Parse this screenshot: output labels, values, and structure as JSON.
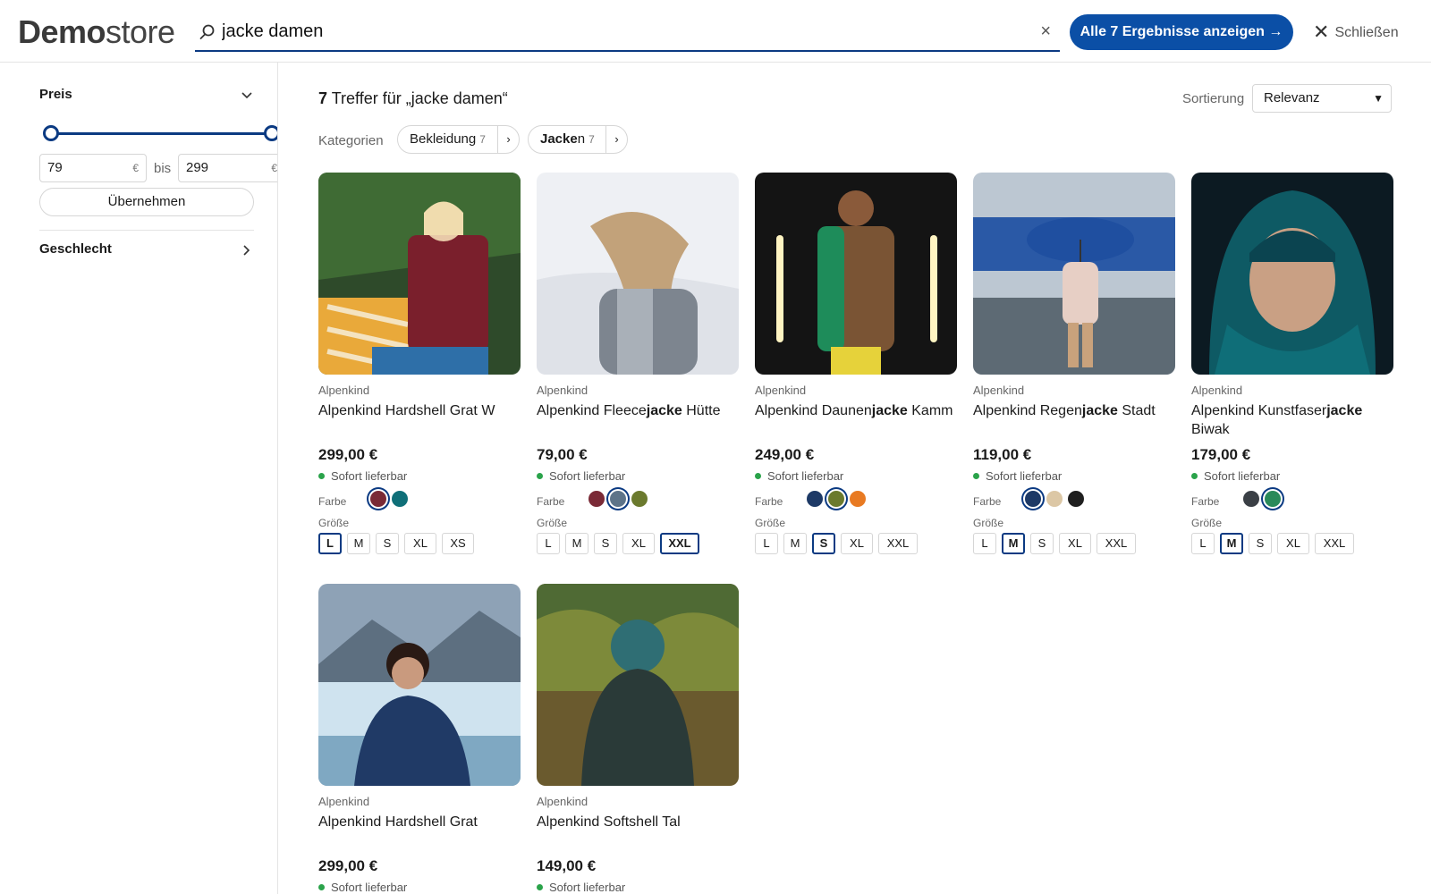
{
  "header": {
    "logo_bold": "Demo",
    "logo_light": "store",
    "search_value": "jacke damen",
    "clear_symbol": "×",
    "cta_label": "Alle 7 Ergebnisse anzeigen →",
    "close_label": "Schließen",
    "close_symbol": "✕"
  },
  "sidebar": {
    "price_title": "Preis",
    "price_min": "79",
    "price_max": "299",
    "currency": "€",
    "bis": "bis",
    "apply_label": "Übernehmen",
    "gender_title": "Geschlecht"
  },
  "main": {
    "results_count": "7",
    "results_text": " Treffer für „jacke damen“",
    "sort_label": "Sortierung",
    "sort_value": "Relevanz",
    "categories_label": "Kategorien",
    "categories": [
      {
        "label": "Bekleidung",
        "count": "7"
      },
      {
        "label_match": "Jacke",
        "label_rest": "n",
        "count": "7"
      }
    ]
  },
  "colors": {
    "accent": "#0b4fa6",
    "accent_dark": "#0b3a82",
    "available": "#2aa34a"
  },
  "products": [
    {
      "brand": "Alpenkind",
      "name_pre": "Alpenkind Hardshell Grat W",
      "name_match": "",
      "name_post": "",
      "price": "299,00 €",
      "availability": "Sofort lieferbar",
      "farbe_label": "Farbe",
      "groesse_label": "Größe",
      "swatches": [
        {
          "color": "#7a2a36",
          "selected": true
        },
        {
          "color": "#0f6f78",
          "selected": false
        }
      ],
      "sizes": [
        "L",
        "M",
        "S",
        "XL",
        "XS"
      ],
      "selected_size": "L"
    },
    {
      "brand": "Alpenkind",
      "name_pre": "Alpenkind Fleece",
      "name_match": "jacke",
      "name_post": " Hütte",
      "price": "79,00 €",
      "availability": "Sofort lieferbar",
      "farbe_label": "Farbe",
      "groesse_label": "Größe",
      "swatches": [
        {
          "color": "#7a2a36",
          "selected": false
        },
        {
          "color": "#5e7489",
          "selected": true
        },
        {
          "color": "#6b7a2e",
          "selected": false
        }
      ],
      "sizes": [
        "L",
        "M",
        "S",
        "XL",
        "XXL"
      ],
      "selected_size": "XXL"
    },
    {
      "brand": "Alpenkind",
      "name_pre": "Alpenkind Daunen",
      "name_match": "jacke",
      "name_post": " Kamm",
      "price": "249,00 €",
      "availability": "Sofort lieferbar",
      "farbe_label": "Farbe",
      "groesse_label": "Größe",
      "swatches": [
        {
          "color": "#1d3966",
          "selected": false
        },
        {
          "color": "#6b7a2e",
          "selected": true
        },
        {
          "color": "#e87a22",
          "selected": false
        }
      ],
      "sizes": [
        "L",
        "M",
        "S",
        "XL",
        "XXL"
      ],
      "selected_size": "S"
    },
    {
      "brand": "Alpenkind",
      "name_pre": "Alpenkind Regen",
      "name_match": "jacke",
      "name_post": " Stadt",
      "price": "119,00 €",
      "availability": "Sofort lieferbar",
      "farbe_label": "Farbe",
      "groesse_label": "Größe",
      "swatches": [
        {
          "color": "#1d3966",
          "selected": true
        },
        {
          "color": "#dcc7a5",
          "selected": false
        },
        {
          "color": "#1f1f1f",
          "selected": false
        }
      ],
      "sizes": [
        "L",
        "M",
        "S",
        "XL",
        "XXL"
      ],
      "selected_size": "M"
    },
    {
      "brand": "Alpenkind",
      "name_pre": "Alpenkind Kunstfaser",
      "name_match": "jacke",
      "name_post": " Biwak",
      "price": "179,00 €",
      "availability": "Sofort lieferbar",
      "farbe_label": "Farbe",
      "groesse_label": "Größe",
      "swatches": [
        {
          "color": "#3a3f45",
          "selected": false
        },
        {
          "color": "#2a8a5a",
          "selected": true
        }
      ],
      "sizes": [
        "L",
        "M",
        "S",
        "XL",
        "XXL"
      ],
      "selected_size": "M"
    },
    {
      "brand": "Alpenkind",
      "name_pre": "Alpenkind Hardshell Grat",
      "name_match": "",
      "name_post": "",
      "price": "299,00 €",
      "availability": "Sofort lieferbar"
    },
    {
      "brand": "Alpenkind",
      "name_pre": "Alpenkind Softshell Tal",
      "name_match": "",
      "name_post": "",
      "price": "149,00 €",
      "availability": "Sofort lieferbar"
    }
  ]
}
